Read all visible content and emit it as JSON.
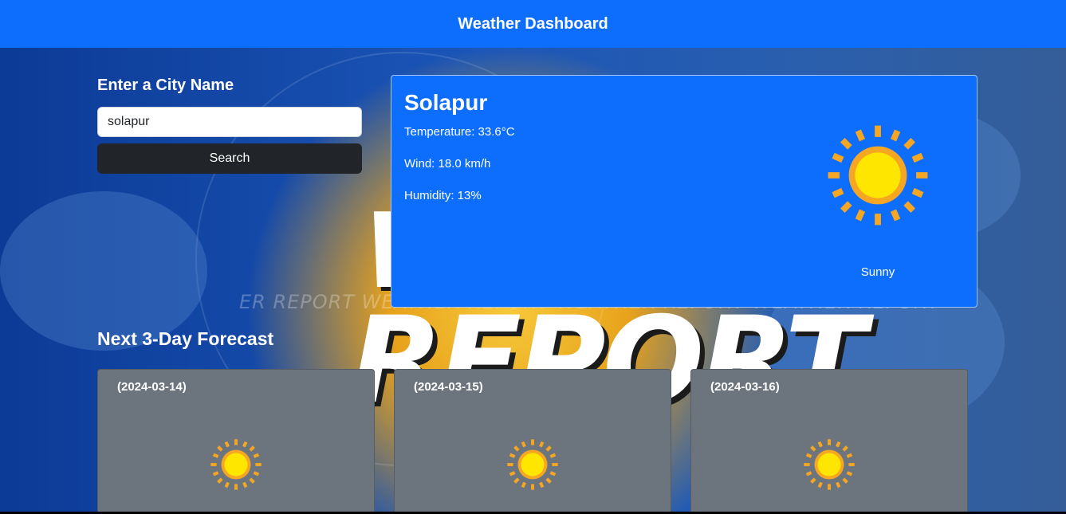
{
  "header": {
    "title": "Weather Dashboard"
  },
  "search": {
    "title": "Enter a City Name",
    "value": "solapur",
    "button_label": "Search"
  },
  "current": {
    "city": "Solapur",
    "temperature": "Temperature: 33.6°C",
    "wind": "Wind: 18.0 km/h",
    "humidity": "Humidity: 13%",
    "condition": "Sunny",
    "icon": "sun-icon"
  },
  "forecast": {
    "title": "Next 3-Day Forecast",
    "days": [
      {
        "date": "(2024-03-14)",
        "icon": "sun-icon"
      },
      {
        "date": "(2024-03-15)",
        "icon": "sun-icon"
      },
      {
        "date": "(2024-03-16)",
        "icon": "sun-icon"
      }
    ]
  },
  "background": {
    "ticker": "ER REPORT   WEATHER REPORT   WEATHER REPORT   WEATHER REPORT",
    "headline_top": "W",
    "headline_bottom": "REPORT"
  },
  "colors": {
    "primary": "#0d6efd",
    "dark_button": "#212529",
    "forecast_card": "#6c757d",
    "sun_outer": "#f5a623",
    "sun_inner": "#ffe600"
  }
}
